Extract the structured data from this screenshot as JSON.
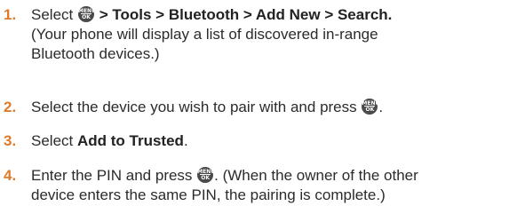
{
  "steps": [
    {
      "number": "1.",
      "line1": {
        "prefix": "Select ",
        "path": "> Tools > Bluetooth > Add New > Search",
        "suffix": "."
      },
      "line2": "(Your phone will display a list of discovered in-range",
      "line3": "Bluetooth devices.)"
    },
    {
      "number": "2.",
      "text": "Select the device you wish to pair with and press ",
      "suffix": "."
    },
    {
      "number": "3.",
      "prefix": "Select ",
      "bold": "Add to Trusted",
      "suffix": "."
    },
    {
      "number": "4.",
      "line1": "Enter the PIN and press ",
      "line1_after": ". (When the owner of the other",
      "line2": "device enters the same PIN, the pairing is complete.)"
    }
  ],
  "menu_key": {
    "icon": "menu-ok-key-icon",
    "top_text": "MENU",
    "bottom_text": "OK",
    "color": "#4a4a4a"
  },
  "colors": {
    "number": "#e07b2a",
    "text": "#2b2b2b"
  }
}
